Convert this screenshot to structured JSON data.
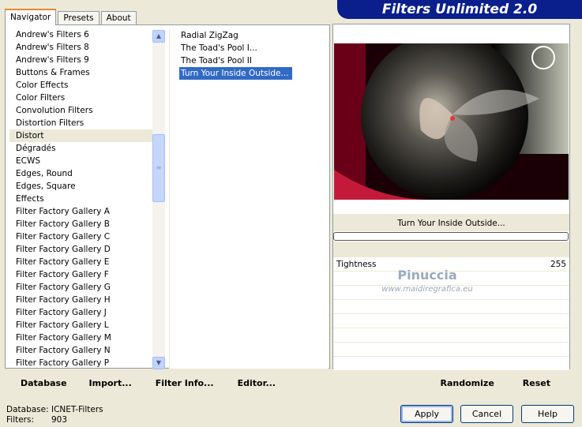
{
  "tabs": [
    {
      "label": "Navigator",
      "active": true
    },
    {
      "label": "Presets",
      "active": false
    },
    {
      "label": "About",
      "active": false
    }
  ],
  "banner": {
    "title": "Filters Unlimited 2.0"
  },
  "categories": [
    "Andrew's Filters 6",
    "Andrew's Filters 8",
    "Andrew's Filters 9",
    "Buttons & Frames",
    "Color Effects",
    "Color Filters",
    "Convolution Filters",
    "Distortion Filters",
    "Distort",
    "Dégradés",
    "ECWS",
    "Edges, Round",
    "Edges, Square",
    "Effects",
    "Filter Factory Gallery A",
    "Filter Factory Gallery B",
    "Filter Factory Gallery C",
    "Filter Factory Gallery D",
    "Filter Factory Gallery E",
    "Filter Factory Gallery F",
    "Filter Factory Gallery G",
    "Filter Factory Gallery H",
    "Filter Factory Gallery J",
    "Filter Factory Gallery L",
    "Filter Factory Gallery M",
    "Filter Factory Gallery N",
    "Filter Factory Gallery P"
  ],
  "selected_category_index": 8,
  "filters": [
    "Radial ZigZag",
    "The Toad's Pool I...",
    "The Toad's Pool II",
    "Turn Your Inside Outside..."
  ],
  "selected_filter_index": 3,
  "preview": {
    "filter_name": "Turn Your Inside Outside...",
    "progress": 0
  },
  "params": [
    {
      "name": "Tightness",
      "value": "255"
    },
    {
      "name": "",
      "value": ""
    },
    {
      "name": "",
      "value": ""
    },
    {
      "name": "",
      "value": ""
    },
    {
      "name": "",
      "value": ""
    },
    {
      "name": "",
      "value": ""
    },
    {
      "name": "",
      "value": ""
    },
    {
      "name": "",
      "value": ""
    }
  ],
  "watermark": {
    "line1": "Pinuccia",
    "line2": "www.maidiregrafica.eu"
  },
  "left_actions": [
    "Database",
    "Import...",
    "Filter Info...",
    "Editor..."
  ],
  "right_actions": [
    "Randomize",
    "Reset"
  ],
  "dbinfo": {
    "database_label": "Database:",
    "database_value": "ICNET-Filters",
    "filters_label": "Filters:",
    "filters_value": "903"
  },
  "buttons": {
    "apply": "Apply",
    "cancel": "Cancel",
    "help": "Help"
  }
}
